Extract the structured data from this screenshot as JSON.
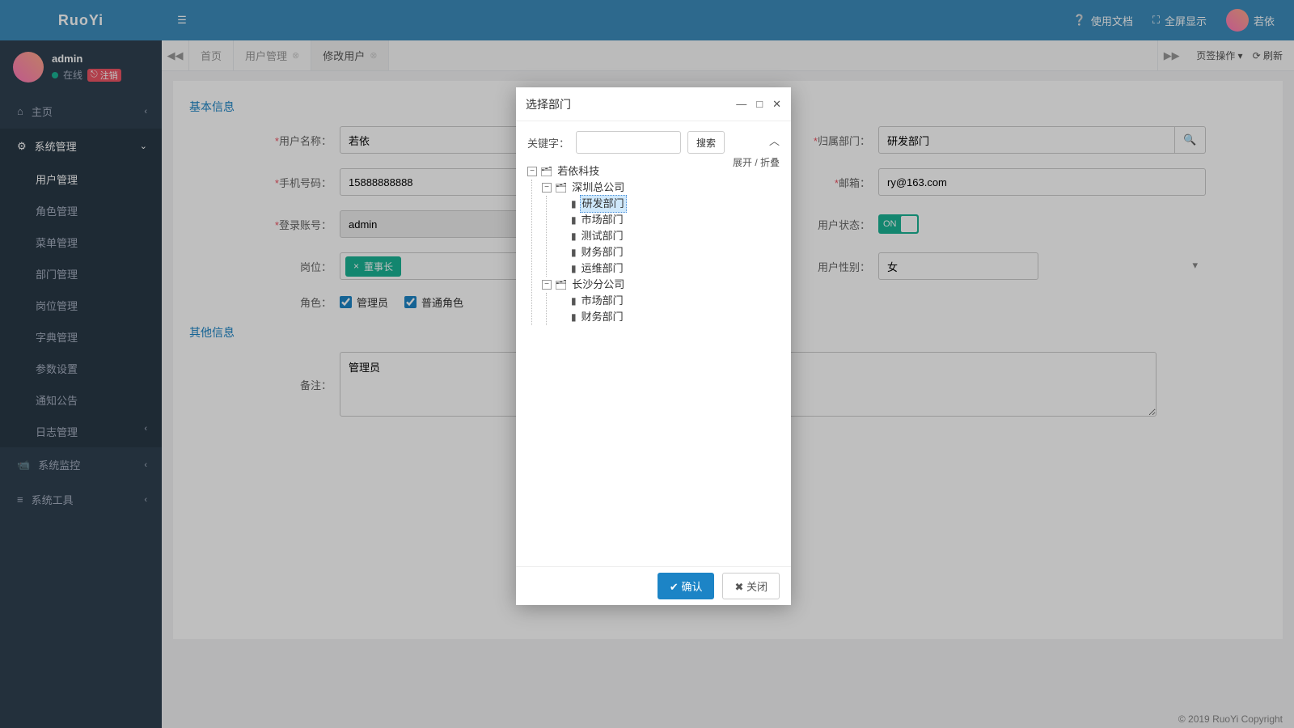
{
  "brand": "RuoYi",
  "topbar": {
    "doc": "使用文档",
    "fullscreen": "全屏显示",
    "username": "若依"
  },
  "user": {
    "name": "admin",
    "status": "在线",
    "logout": "注销"
  },
  "nav": {
    "home": "主页",
    "sys": "系统管理",
    "sys_items": [
      "用户管理",
      "角色管理",
      "菜单管理",
      "部门管理",
      "岗位管理",
      "字典管理",
      "参数设置",
      "通知公告",
      "日志管理"
    ],
    "monitor": "系统监控",
    "tool": "系统工具"
  },
  "tabs": {
    "home": "首页",
    "user": "用户管理",
    "edit": "修改用户",
    "actions": "页签操作",
    "refresh": "刷新"
  },
  "form": {
    "section_basic": "基本信息",
    "section_other": "其他信息",
    "username_label": "用户名称：",
    "username_value": "若依",
    "dept_label": "归属部门：",
    "dept_value": "研发部门",
    "phone_label": "手机号码：",
    "phone_value": "15888888888",
    "email_label": "邮箱：",
    "email_value": "ry@163.com",
    "login_label": "登录账号：",
    "login_value": "admin",
    "status_label": "用户状态：",
    "status_value": "ON",
    "post_label": "岗位：",
    "post_chip": "董事长",
    "sex_label": "用户性别：",
    "sex_value": "女",
    "role_label": "角色：",
    "role_admin": "管理员",
    "role_normal": "普通角色",
    "remark_label": "备注：",
    "remark_value": "管理员"
  },
  "dialog": {
    "title": "选择部门",
    "keyword_label": "关键字：",
    "search_btn": "搜索",
    "expand": "展开 / 折叠",
    "confirm": "确认",
    "close": "关闭",
    "tree": {
      "root": "若依科技",
      "c1": "深圳总公司",
      "c1_children": [
        "研发部门",
        "市场部门",
        "测试部门",
        "财务部门",
        "运维部门"
      ],
      "c2": "长沙分公司",
      "c2_children": [
        "市场部门",
        "财务部门"
      ],
      "selected": "研发部门"
    }
  },
  "footer": "© 2019 RuoYi Copyright"
}
